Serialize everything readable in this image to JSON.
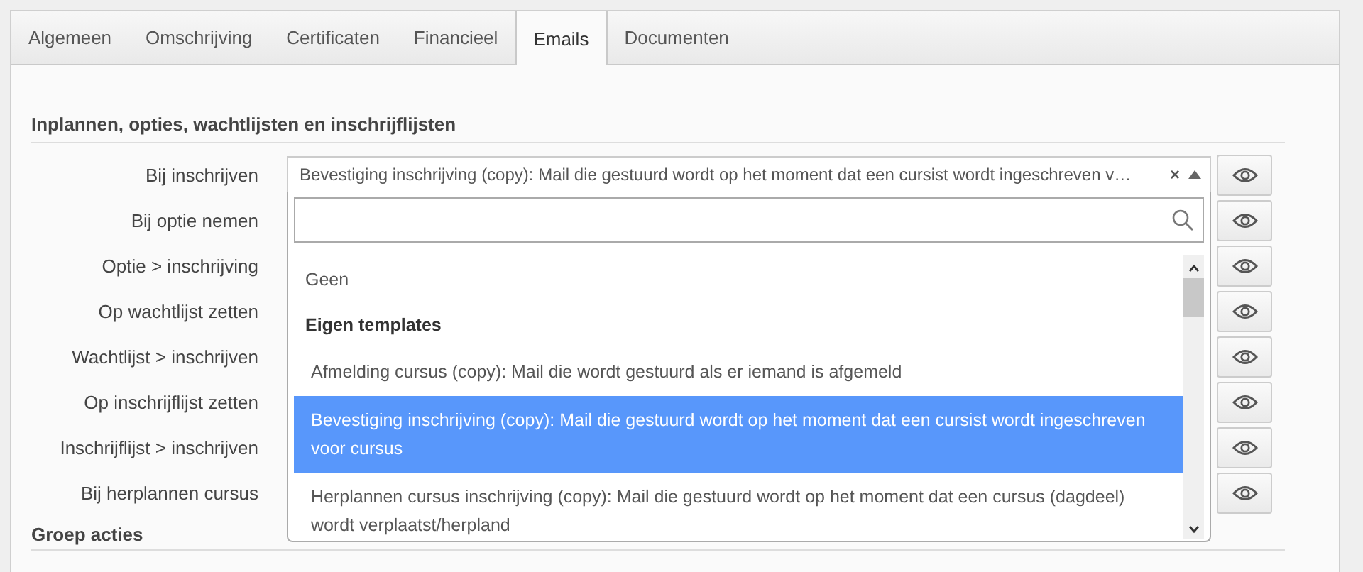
{
  "tabs": [
    {
      "label": "Algemeen",
      "selected": false
    },
    {
      "label": "Omschrijving",
      "selected": false
    },
    {
      "label": "Certificaten",
      "selected": false
    },
    {
      "label": "Financieel",
      "selected": false
    },
    {
      "label": "Emails",
      "selected": true
    },
    {
      "label": "Documenten",
      "selected": false
    }
  ],
  "sections": [
    {
      "heading": "Inplannen, opties, wachtlijsten en inschrijflijsten",
      "rows": [
        {
          "label": "Bij inschrijven",
          "value": "Bevestiging inschrijving (copy): Mail die gestuurd wordt op het moment dat een cursist wordt ingeschreven v…",
          "clear": "×",
          "expanded": true
        },
        {
          "label": "Bij optie nemen"
        },
        {
          "label": "Optie > inschrijving"
        },
        {
          "label": "Op wachtlijst zetten"
        },
        {
          "label": "Wachtlijst > inschrijven"
        },
        {
          "label": "Op inschrijflijst zetten"
        },
        {
          "label": "Inschrijflijst > inschrijven"
        },
        {
          "label": "Bij herplannen cursus"
        }
      ]
    },
    {
      "heading": "Groep acties"
    }
  ],
  "dropdown": {
    "options": [
      {
        "kind": "option",
        "label": "Geen",
        "selected": false
      },
      {
        "kind": "group",
        "label": "Eigen templates",
        "children": [
          {
            "kind": "option",
            "label": "Afmelding cursus (copy): Mail die wordt gestuurd als er iemand is afgemeld",
            "selected": false
          },
          {
            "kind": "option",
            "label": "Bevestiging inschrijving (copy): Mail die gestuurd wordt op het moment dat een cursist wordt ingeschreven voor cursus",
            "selected": true
          },
          {
            "kind": "option",
            "label": "Herplannen cursus inschrijving (copy): Mail die gestuurd wordt op het moment dat een cursus (dagdeel) wordt verplaatst/herpland",
            "selected": false
          }
        ]
      }
    ]
  }
}
